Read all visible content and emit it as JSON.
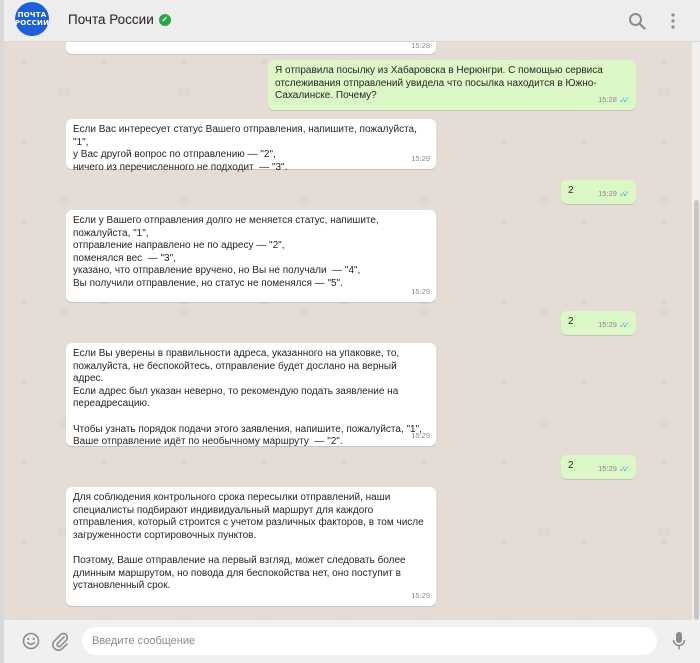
{
  "header": {
    "avatar_line1": "ПОЧТА",
    "avatar_line2": "РОССИИ",
    "title": "Почта России",
    "verified_icon": "verified-check-icon",
    "search_icon": "search-icon",
    "menu_icon": "more-vertical-icon"
  },
  "colors": {
    "header_bg": "#ededed",
    "chat_bg": "#e5ddd5",
    "incoming_bubble": "#ffffff",
    "outgoing_bubble": "#dcf8c6",
    "read_ticks": "#4fb3e8",
    "verified": "#25a647",
    "avatar": "#1c5fd6"
  },
  "messages": [
    {
      "direction": "in",
      "text": "",
      "time": "15:28"
    },
    {
      "direction": "out",
      "text": "Я отправила посылку из Хабаровска в Нерюнгри. С помощью сервиса\nотслеживания отправлений увидела что посылка находится в Южно-\nСахалинске. Почему?",
      "time": "15:28",
      "status": "read"
    },
    {
      "direction": "in",
      "text": "Если Вас интересует статус Вашего отправления, напишите, пожалуйста, \"1\",\nу Вас другой вопрос по отправлению — \"2\",\nничего из перечисленного не подходит  — \"3\".",
      "time": "15:29"
    },
    {
      "direction": "out",
      "text": "2",
      "time": "15:29",
      "status": "read"
    },
    {
      "direction": "in",
      "text": "Если у Вашего отправления долго не меняется статус, напишите,\nпожалуйста, \"1\",\nотправление направлено не по адресу — \"2\",\nпоменялся вес  — \"3\",\nуказано, что отправление вручено, но Вы не получали  — \"4\",\nВы получили отправление, но статус не поменялся — \"5\".",
      "time": "15:29"
    },
    {
      "direction": "out",
      "text": "2",
      "time": "15:29",
      "status": "read"
    },
    {
      "direction": "in",
      "text": "Если Вы уверены в правильности адреса, указанного на упаковке, то,\nпожалуйста, не беспокойтесь, отправление будет дослано на верный адрес.\nЕсли адрес был указан неверно, то рекомендую подать заявление на\nпереадресацию.\n\nЧтобы узнать порядок подачи этого заявления, напишите, пожалуйста, \"1\",\nВаше отправление идёт по необычному маршруту  — \"2\".",
      "time": "15:29"
    },
    {
      "direction": "out",
      "text": "2",
      "time": "15:29",
      "status": "read"
    },
    {
      "direction": "in",
      "text": "Для соблюдения контрольного срока пересылки отправлений, наши\nспециалисты подбирают индивидуальный маршрут для каждого\nотправления, который строится с учетом различных факторов, в том числе\nзагруженности сортировочных пунктов.\n\nПоэтому, Ваше отправление на первый взгляд, может следовать более\nдлинным маршрутом, но повода для беспокойства нет, оно поступит в\nустановленный срок.",
      "time": "15:29"
    }
  ],
  "composer": {
    "placeholder": "Введите сообщение",
    "emoji_icon": "emoji-icon",
    "attach_icon": "paperclip-icon",
    "mic_icon": "microphone-icon"
  }
}
